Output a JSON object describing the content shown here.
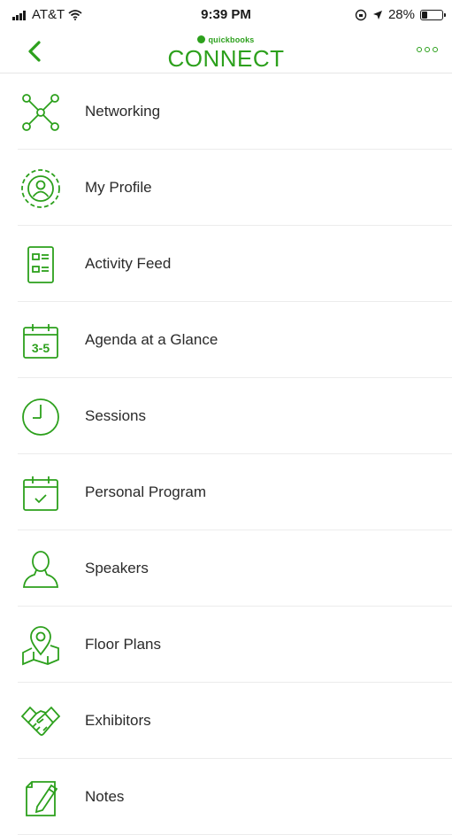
{
  "status_bar": {
    "carrier": "AT&T",
    "time": "9:39 PM",
    "battery_percent": "28%",
    "battery_level": 0.28
  },
  "nav": {
    "brand_small": "quickbooks",
    "brand_main": "CONNECT",
    "back_icon": "chevron-left-icon",
    "more_icon": "more-dots-icon"
  },
  "colors": {
    "accent": "#2ca01c",
    "text": "#2a2a2a",
    "divider": "#ececec"
  },
  "menu": {
    "items": [
      {
        "label": "Networking",
        "icon": "network-icon"
      },
      {
        "label": "My Profile",
        "icon": "profile-icon"
      },
      {
        "label": "Activity Feed",
        "icon": "activity-feed-icon"
      },
      {
        "label": "Agenda at a Glance",
        "icon": "calendar-range-icon",
        "icon_text": "3-5"
      },
      {
        "label": "Sessions",
        "icon": "clock-icon"
      },
      {
        "label": "Personal Program",
        "icon": "calendar-check-icon"
      },
      {
        "label": "Speakers",
        "icon": "speaker-person-icon"
      },
      {
        "label": "Floor Plans",
        "icon": "map-pin-icon"
      },
      {
        "label": "Exhibitors",
        "icon": "handshake-icon"
      },
      {
        "label": "Notes",
        "icon": "notes-pen-icon"
      }
    ]
  }
}
